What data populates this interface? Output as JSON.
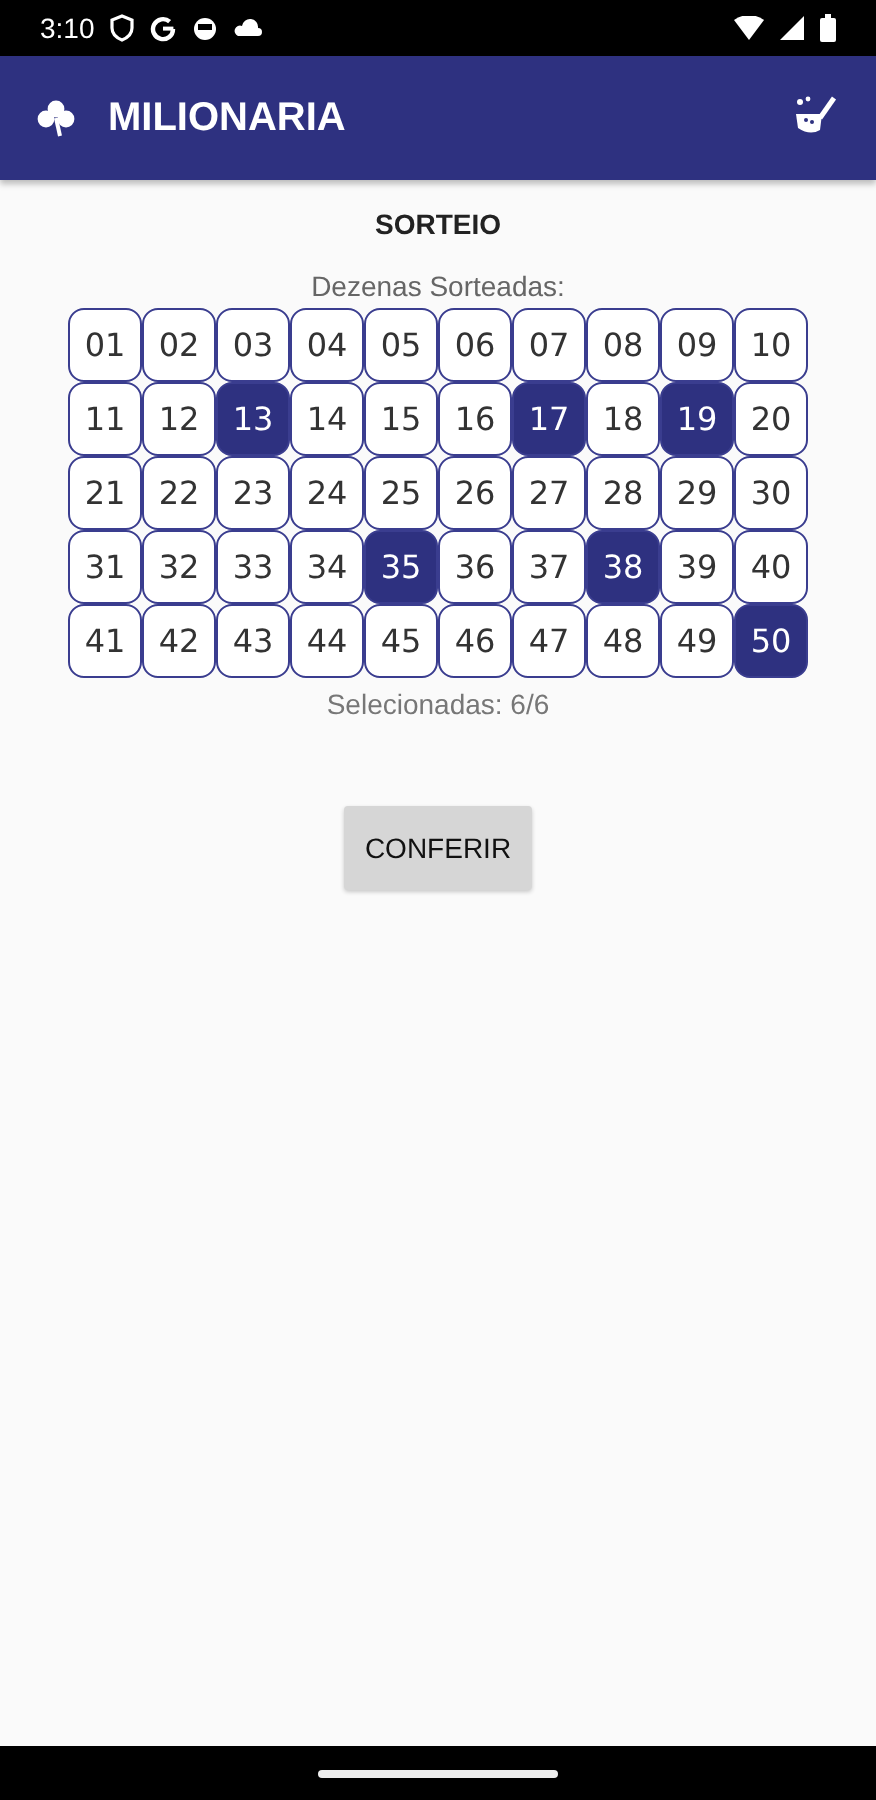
{
  "status_bar": {
    "time": "3:10"
  },
  "app_bar": {
    "title": "MILIONARIA"
  },
  "section_title": "SORTEIO",
  "grid_label": "Dezenas Sorteadas:",
  "numbers": [
    {
      "label": "01",
      "selected": false
    },
    {
      "label": "02",
      "selected": false
    },
    {
      "label": "03",
      "selected": false
    },
    {
      "label": "04",
      "selected": false
    },
    {
      "label": "05",
      "selected": false
    },
    {
      "label": "06",
      "selected": false
    },
    {
      "label": "07",
      "selected": false
    },
    {
      "label": "08",
      "selected": false
    },
    {
      "label": "09",
      "selected": false
    },
    {
      "label": "10",
      "selected": false
    },
    {
      "label": "11",
      "selected": false
    },
    {
      "label": "12",
      "selected": false
    },
    {
      "label": "13",
      "selected": true
    },
    {
      "label": "14",
      "selected": false
    },
    {
      "label": "15",
      "selected": false
    },
    {
      "label": "16",
      "selected": false
    },
    {
      "label": "17",
      "selected": true
    },
    {
      "label": "18",
      "selected": false
    },
    {
      "label": "19",
      "selected": true
    },
    {
      "label": "20",
      "selected": false
    },
    {
      "label": "21",
      "selected": false
    },
    {
      "label": "22",
      "selected": false
    },
    {
      "label": "23",
      "selected": false
    },
    {
      "label": "24",
      "selected": false
    },
    {
      "label": "25",
      "selected": false
    },
    {
      "label": "26",
      "selected": false
    },
    {
      "label": "27",
      "selected": false
    },
    {
      "label": "28",
      "selected": false
    },
    {
      "label": "29",
      "selected": false
    },
    {
      "label": "30",
      "selected": false
    },
    {
      "label": "31",
      "selected": false
    },
    {
      "label": "32",
      "selected": false
    },
    {
      "label": "33",
      "selected": false
    },
    {
      "label": "34",
      "selected": false
    },
    {
      "label": "35",
      "selected": true
    },
    {
      "label": "36",
      "selected": false
    },
    {
      "label": "37",
      "selected": false
    },
    {
      "label": "38",
      "selected": true
    },
    {
      "label": "39",
      "selected": false
    },
    {
      "label": "40",
      "selected": false
    },
    {
      "label": "41",
      "selected": false
    },
    {
      "label": "42",
      "selected": false
    },
    {
      "label": "43",
      "selected": false
    },
    {
      "label": "44",
      "selected": false
    },
    {
      "label": "45",
      "selected": false
    },
    {
      "label": "46",
      "selected": false
    },
    {
      "label": "47",
      "selected": false
    },
    {
      "label": "48",
      "selected": false
    },
    {
      "label": "49",
      "selected": false
    },
    {
      "label": "50",
      "selected": true
    }
  ],
  "selection_count": "Selecionadas: 6/6",
  "button": "CONFERIR"
}
